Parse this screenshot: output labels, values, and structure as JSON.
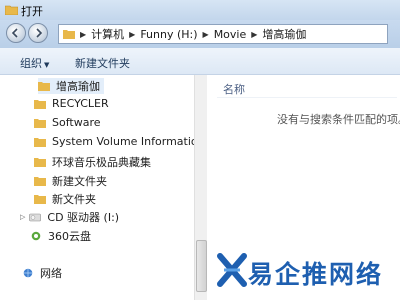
{
  "window": {
    "title": "打开"
  },
  "address": {
    "crumbs": [
      "计算机",
      "Funny (H:)",
      "Movie",
      "增高瑜伽"
    ]
  },
  "toolbar": {
    "organize_label": "组织",
    "new_folder_label": "新建文件夹"
  },
  "tree": {
    "items": [
      {
        "label": "增高瑜伽",
        "icon": "folder-icon",
        "selected": true
      },
      {
        "label": "RECYCLER",
        "icon": "folder-icon"
      },
      {
        "label": "Software",
        "icon": "folder-icon"
      },
      {
        "label": "System Volume Information",
        "icon": "folder-icon"
      },
      {
        "label": "环球音乐极品典藏集",
        "icon": "folder-icon"
      },
      {
        "label": "新建文件夹",
        "icon": "folder-icon"
      },
      {
        "label": "新文件夹",
        "icon": "folder-icon"
      },
      {
        "label": "CD 驱动器 (I:)",
        "icon": "cd-drive-icon"
      },
      {
        "label": "360云盘",
        "icon": "cloud-drive-icon"
      },
      {
        "label": "网络",
        "icon": "network-icon"
      }
    ]
  },
  "content": {
    "column_name": "名称",
    "empty_message": "没有与搜索条件匹配的项。"
  },
  "watermark": {
    "text": "易企推网络"
  },
  "colors": {
    "folder": "#e8b84a",
    "accent": "#1e5fb0",
    "titlebar": "#c8daef"
  }
}
